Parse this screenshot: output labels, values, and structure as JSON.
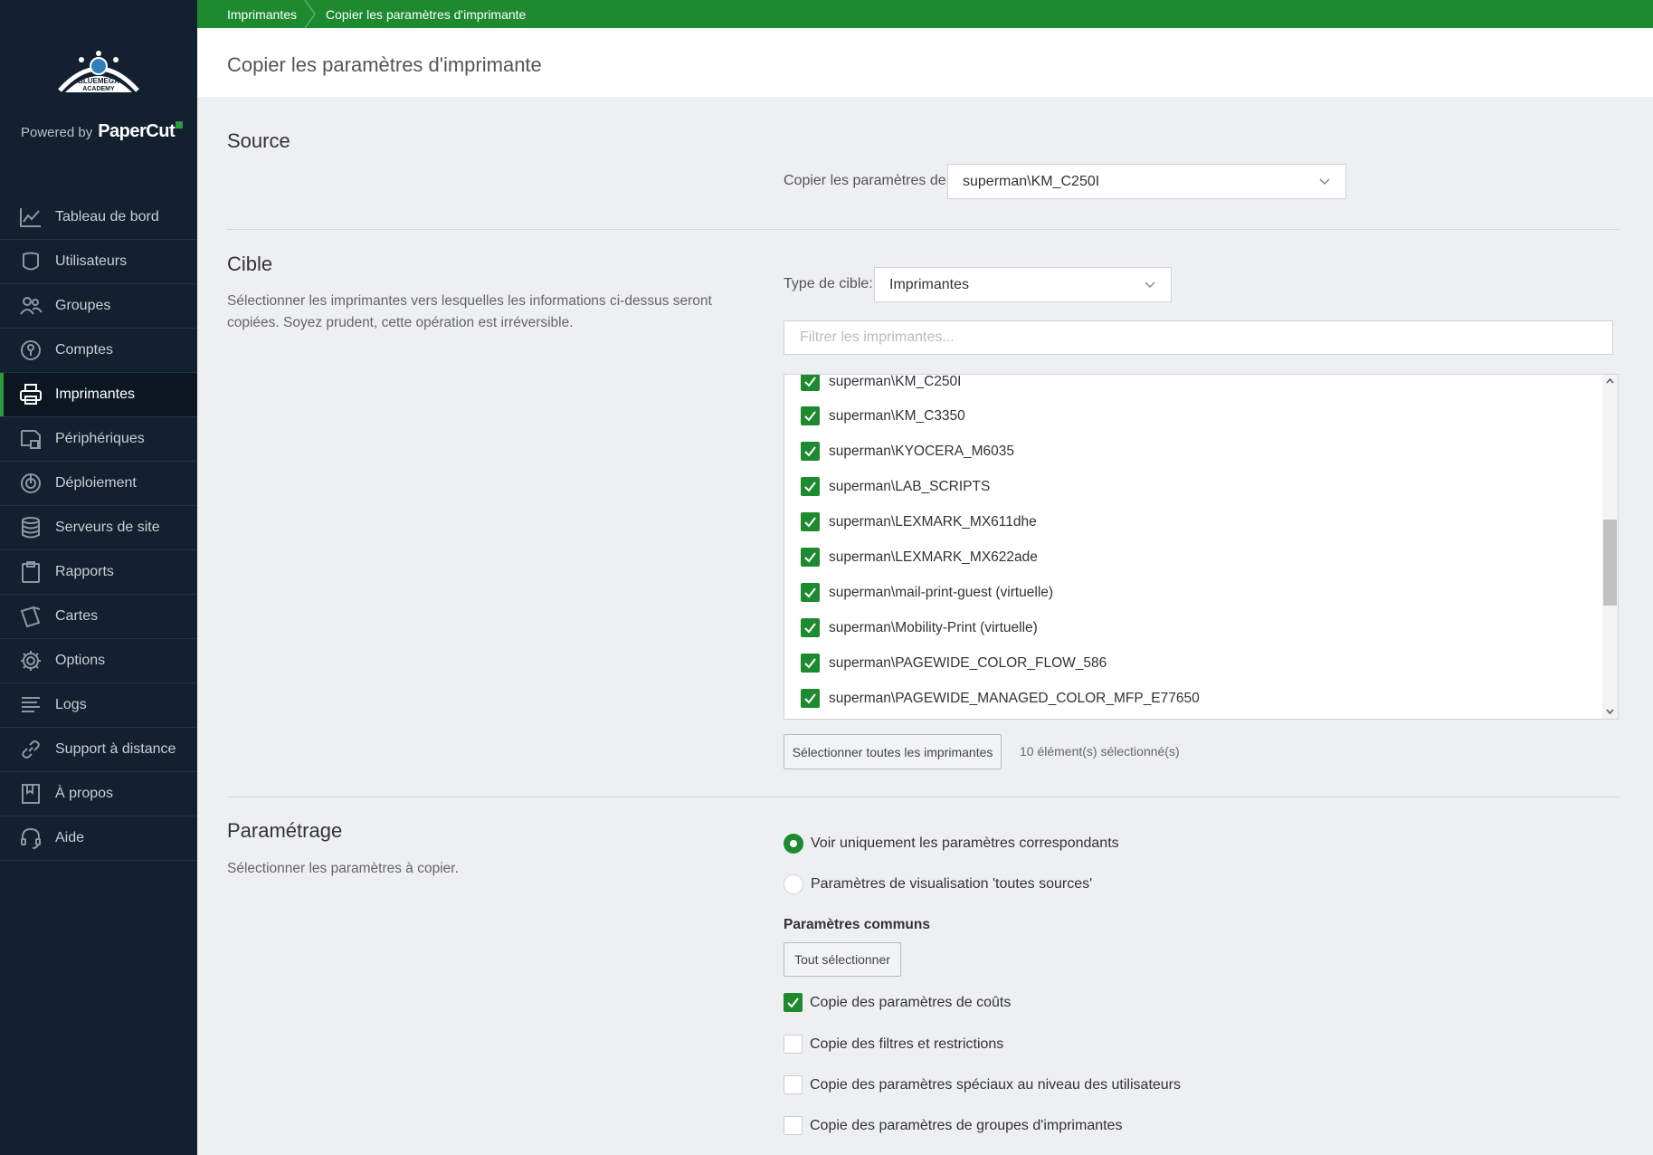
{
  "sidebar": {
    "logo_text": "BLUEMEGA ACADEMY",
    "powered_by": "Powered by",
    "brand": "PaperCut",
    "items": [
      {
        "label": "Tableau de bord",
        "icon": "chart-line-icon"
      },
      {
        "label": "Utilisateurs",
        "icon": "user-icon"
      },
      {
        "label": "Groupes",
        "icon": "users-icon"
      },
      {
        "label": "Comptes",
        "icon": "account-icon"
      },
      {
        "label": "Imprimantes",
        "icon": "printer-icon",
        "active": true
      },
      {
        "label": "Périphériques",
        "icon": "device-icon"
      },
      {
        "label": "Déploiement",
        "icon": "deploy-icon"
      },
      {
        "label": "Serveurs de site",
        "icon": "database-icon"
      },
      {
        "label": "Rapports",
        "icon": "clipboard-icon"
      },
      {
        "label": "Cartes",
        "icon": "cards-icon"
      },
      {
        "label": "Options",
        "icon": "gear-icon"
      },
      {
        "label": "Logs",
        "icon": "lines-icon"
      },
      {
        "label": "Support à distance",
        "icon": "link-icon"
      },
      {
        "label": "À propos",
        "icon": "book-icon"
      },
      {
        "label": "Aide",
        "icon": "headset-icon"
      }
    ]
  },
  "breadcrumb": {
    "root": "Imprimantes",
    "current": "Copier les paramètres d'imprimante"
  },
  "page": {
    "title": "Copier les paramètres d'imprimante"
  },
  "source": {
    "title": "Source",
    "copy_from_label": "Copier les paramètres de:",
    "copy_from_value": "superman\\KM_C250I"
  },
  "target": {
    "title": "Cible",
    "description": "Sélectionner les imprimantes vers lesquelles les informations ci-dessus seront copiées. Soyez prudent, cette opération est irréversible.",
    "type_label": "Type de cible:",
    "type_value": "Imprimantes",
    "filter_placeholder": "Filtrer les imprimantes...",
    "printers": [
      "superman\\KM_C250I",
      "superman\\KM_C3350",
      "superman\\KYOCERA_M6035",
      "superman\\LAB_SCRIPTS",
      "superman\\LEXMARK_MX611dhe",
      "superman\\LEXMARK_MX622ade",
      "superman\\mail-print-guest (virtuelle)",
      "superman\\Mobility-Print (virtuelle)",
      "superman\\PAGEWIDE_COLOR_FLOW_586",
      "superman\\PAGEWIDE_MANAGED_COLOR_MFP_E77650"
    ],
    "select_all_label": "Sélectionner toutes les imprimantes",
    "selected_count": "10 élément(s) sélectionné(s)"
  },
  "settings": {
    "title": "Paramétrage",
    "description": "Sélectionner les paramètres à copier.",
    "radio_matching": "Voir uniquement les paramètres correspondants",
    "radio_all": "Paramètres de visualisation 'toutes sources'",
    "common_heading": "Paramètres communs",
    "select_all": "Tout sélectionner",
    "options": [
      {
        "label": "Copie des paramètres de coûts",
        "checked": true
      },
      {
        "label": "Copie des filtres et restrictions",
        "checked": false
      },
      {
        "label": "Copie des paramètres spéciaux au niveau des utilisateurs",
        "checked": false
      },
      {
        "label": "Copie des paramètres de groupes d'imprimantes",
        "checked": false
      }
    ]
  },
  "colors": {
    "accent": "#1e8a2f",
    "sidebar": "#12202f"
  }
}
